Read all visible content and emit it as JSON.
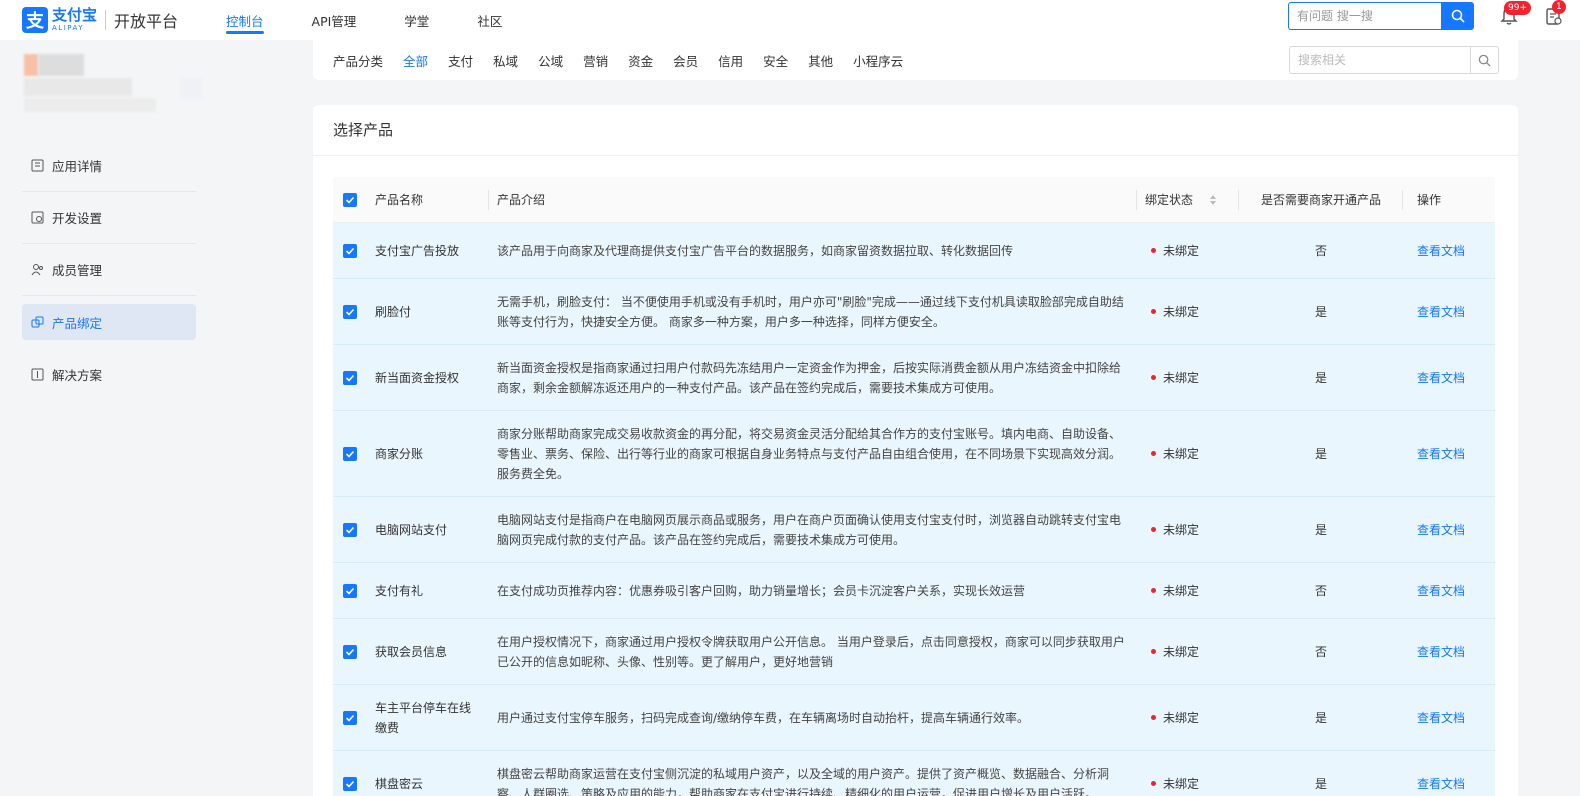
{
  "header": {
    "logo_mark": "支",
    "logo_cn": "支付宝",
    "logo_en": "ALIPAY",
    "platform": "开放平台",
    "nav": [
      {
        "label": "控制台",
        "active": true
      },
      {
        "label": "API管理"
      },
      {
        "label": "学堂"
      },
      {
        "label": "社区"
      }
    ],
    "search_placeholder": "有问题 搜一搜",
    "bell_badge": "99+",
    "notice_badge": "1"
  },
  "sidebar": {
    "items": [
      {
        "label": "应用详情",
        "icon": "app-detail-icon"
      },
      {
        "label": "开发设置",
        "icon": "dev-settings-icon"
      },
      {
        "label": "成员管理",
        "icon": "members-icon"
      },
      {
        "label": "产品绑定",
        "icon": "product-bind-icon",
        "active": true
      },
      {
        "label": "解决方案",
        "icon": "solution-icon"
      }
    ]
  },
  "filter": {
    "label": "产品分类",
    "categories": [
      "全部",
      "支付",
      "私域",
      "公域",
      "营销",
      "资金",
      "会员",
      "信用",
      "安全",
      "其他",
      "小程序云"
    ],
    "active": "全部",
    "search_placeholder": "搜索相关"
  },
  "main": {
    "title": "选择产品",
    "columns": {
      "name": "产品名称",
      "desc": "产品介绍",
      "status": "绑定状态",
      "need": "是否需要商家开通产品",
      "op": "操作"
    },
    "rows": [
      {
        "name": "支付宝广告投放",
        "desc": "该产品用于向商家及代理商提供支付宝广告平台的数据服务，如商家留资数据拉取、转化数据回传",
        "status": "未绑定",
        "need": "否",
        "op": "查看文档"
      },
      {
        "name": "刷脸付",
        "desc": "无需手机，刷脸支付： 当不便使用手机或没有手机时，用户亦可\"刷脸\"完成——通过线下支付机具读取脸部完成自助结账等支付行为，快捷安全方便。 商家多一种方案，用户多一种选择，同样方便安全。",
        "status": "未绑定",
        "need": "是",
        "op": "查看文档"
      },
      {
        "name": "新当面资金授权",
        "desc": "新当面资金授权是指商家通过扫用户付款码先冻结用户一定资金作为押金，后按实际消费金额从用户冻结资金中扣除给商家，剩余金额解冻返还用户的一种支付产品。该产品在签约完成后，需要技术集成方可使用。",
        "status": "未绑定",
        "need": "是",
        "op": "查看文档"
      },
      {
        "name": "商家分账",
        "desc": "商家分账帮助商家完成交易收款资金的再分配，将交易资金灵活分配给其合作方的支付宝账号。填内电商、自助设备、零售业、票务、保险、出行等行业的商家可根据自身业务特点与支付产品自由组合使用，在不同场景下实现高效分润。服务费全免。",
        "status": "未绑定",
        "need": "是",
        "op": "查看文档"
      },
      {
        "name": "电脑网站支付",
        "desc": "电脑网站支付是指商户在电脑网页展示商品或服务，用户在商户页面确认使用支付宝支付时，浏览器自动跳转支付宝电脑网页完成付款的支付产品。该产品在签约完成后，需要技术集成方可使用。",
        "status": "未绑定",
        "need": "是",
        "op": "查看文档"
      },
      {
        "name": "支付有礼",
        "desc": "在支付成功页推荐内容：优惠券吸引客户回购，助力销量增长；会员卡沉淀客户关系，实现长效运营",
        "status": "未绑定",
        "need": "否",
        "op": "查看文档"
      },
      {
        "name": "获取会员信息",
        "desc": "在用户授权情况下，商家通过用户授权令牌获取用户公开信息。 当用户登录后，点击同意授权，商家可以同步获取用户已公开的信息如昵称、头像、性别等。更了解用户，更好地营销",
        "status": "未绑定",
        "need": "否",
        "op": "查看文档"
      },
      {
        "name": "车主平台停车在线缴费",
        "desc": "用户通过支付宝停车服务，扫码完成查询/缴纳停车费，在车辆离场时自动抬杆，提高车辆通行效率。",
        "status": "未绑定",
        "need": "是",
        "op": "查看文档"
      },
      {
        "name": "棋盘密云",
        "desc": "棋盘密云帮助商家运营在支付宝侧沉淀的私域用户资产，以及全域的用户资产。提供了资产概览、数据融合、分析洞察、人群圈选、策略及应用的能力，帮助商家在支付宝进行持续、精细化的用户运营，促进用户增长及用户活跃。",
        "status": "未绑定",
        "need": "是",
        "op": "查看文档"
      }
    ]
  }
}
